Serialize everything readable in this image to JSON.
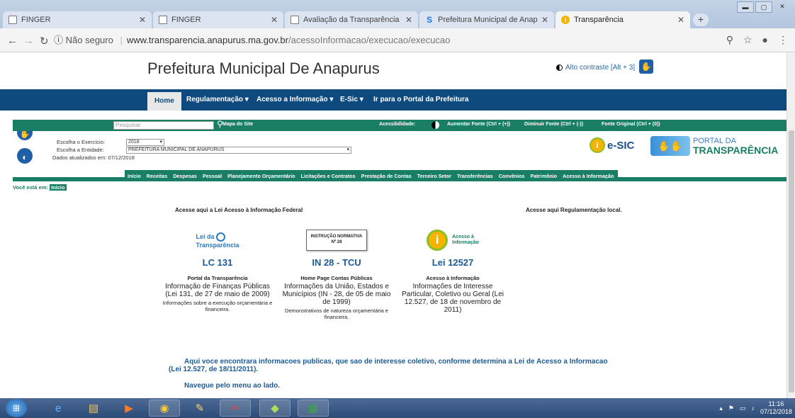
{
  "browser": {
    "tabs": [
      {
        "title": "FINGER",
        "icon": "document-icon",
        "active": false
      },
      {
        "title": "FINGER",
        "icon": "document-icon",
        "active": false
      },
      {
        "title": "Avaliação da Transparência do",
        "icon": "document-icon",
        "active": false
      },
      {
        "title": "Prefeitura Municipal de Anapu",
        "icon": "s-logo-icon",
        "active": false
      },
      {
        "title": "Transparência",
        "icon": "info-icon",
        "active": true
      }
    ],
    "security_label": "Não seguro",
    "url_host": "www.transparencia.anapurus.ma.gov.br",
    "url_path": "/acessoInformacao/execucao/execucao"
  },
  "site": {
    "title": "Prefeitura Municipal De Anapurus",
    "contrast_label": "Alto contraste [Alt + 3]"
  },
  "mainnav": {
    "home": "Home",
    "regulamentacao": "Regulamentação",
    "acesso": "Acesso a Informação",
    "esic": "E-Sic",
    "portal": "Ir para o Portal da Prefeitura"
  },
  "portal_bar": {
    "search_placeholder": "Pesquisar",
    "mapa": "Mapa do Site",
    "acessibilidade": "Acessibilidade:",
    "aumentar": "Aumentar Fonte (Ctrl + (+))",
    "diminuir": "Diminuir Fonte (Ctrl + (-))",
    "original": "Fonte Original (Ctrl + (0))"
  },
  "filters": {
    "exercicio_label": "Escolha o Exercício:",
    "exercicio_value": "2018",
    "entidade_label": "Escolha a Entidade:",
    "entidade_value": "PREFEITURA MUNICIPAL DE ANAPURUS",
    "atualizados": "Dados atualizados em: 07/12/2018"
  },
  "brands": {
    "esic": "e-SIC",
    "portal_da": "PORTAL DA",
    "transparencia": "TRANSPARÊNCIA"
  },
  "subnav": [
    "Início",
    "Receitas",
    "Despesas",
    "Pessoal",
    "Planejamento Orçamentário",
    "Licitações e Contratos",
    "Prestação de Contas",
    "Terceiro Setor",
    "Transferências",
    "Convênios",
    "Patrimônio",
    "Acesso à Informação"
  ],
  "breadcrumb": {
    "label": "Você está em:",
    "current": "Início"
  },
  "headings": {
    "left": "Acesse aqui a Lei Acesso à Informação Federal",
    "right": "Acesse aqui Regulamentação local."
  },
  "cards": [
    {
      "logo_line1": "Lei da",
      "logo_line2": "Transparência",
      "code": "LC 131",
      "title": "Portal da Transparência",
      "desc": "Informação de Finanças Públicas (Lei 131, de 27 de maio de 2009)",
      "note": "Informações sobre a execução orçamentária e financeira."
    },
    {
      "logo_line1": "INSTRUÇÃO NORMATIVA",
      "logo_line2": "Nº 28",
      "code": "IN 28 - TCU",
      "title": "Home Page Contas Públicas",
      "desc": "Informações da União, Estados e Municípios (IN - 28, de 05 de maio de 1999)",
      "note": "Demonstrativos de natureza orçamentária e financeira."
    },
    {
      "logo_line1": "Acesso à",
      "logo_line2": "Informação",
      "code": "Lei 12527",
      "title": "Acesso à Informação",
      "desc": "Informações de Interesse Particular, Coletivo ou Geral (Lei 12.527, de 18 de novembro de 2011)",
      "note": ""
    }
  ],
  "intro": {
    "line1": "Aqui voce encontrara informacoes publicas, que sao de interesse coletivo, conforme determina a Lei de Acesso a Informacao",
    "line2": "(Lei 12.527, de 18/11/2011).",
    "hint": "Navegue pelo menu ao lado."
  },
  "taskbar": {
    "time": "11:16",
    "date": "07/12/2018"
  }
}
